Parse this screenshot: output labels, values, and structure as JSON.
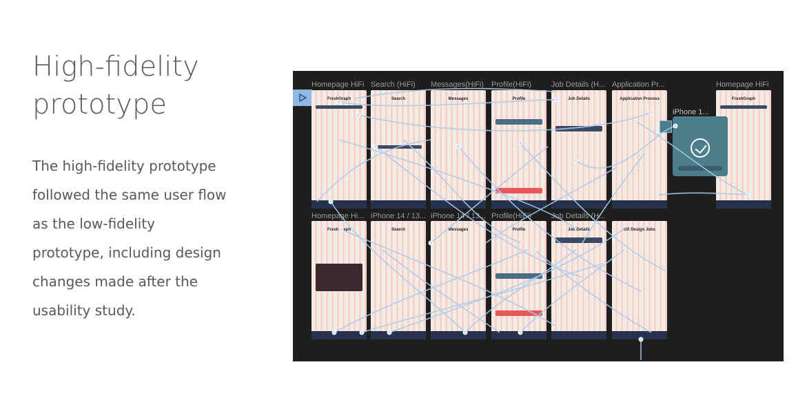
{
  "heading": [
    "High-fidelity",
    "prototype"
  ],
  "body_lines": [
    "The high-fidelity prototype",
    "followed the same user flow",
    "as the low-fidelity",
    "prototype, including design",
    "changes made after the",
    "usability study."
  ],
  "canvas": {
    "background": "#1e1e1e",
    "connector_color": "#a9cdee",
    "play_icon": "play-icon",
    "frames": [
      {
        "label": "Homepage HiFi",
        "title": "FreshGraph"
      },
      {
        "label": "Search (HiFi)",
        "title": "Search"
      },
      {
        "label": "Messages(HiFi)",
        "title": "Messages"
      },
      {
        "label": "Profile(HiFi)",
        "title": "Profile"
      },
      {
        "label": "Job Details (H...",
        "title": "Job Details"
      },
      {
        "label": "Application Pr...",
        "title": "Application Process"
      },
      {
        "label": "Homepage HiFi",
        "title": "FreshGraph"
      },
      {
        "label": "Homepage Hi...",
        "title": "FreshGraph"
      },
      {
        "label": "iPhone 14 / 13...",
        "title": "Search"
      },
      {
        "label": "iPhone 14 / 13...",
        "title": "Messages"
      },
      {
        "label": "Profile(HiFi)",
        "title": "Profile"
      },
      {
        "label": "Job Details (H...",
        "title": "Job Details"
      },
      {
        "label": "",
        "title": "UX Design Jobs"
      }
    ],
    "overlay_label": "iPhone 1..."
  }
}
